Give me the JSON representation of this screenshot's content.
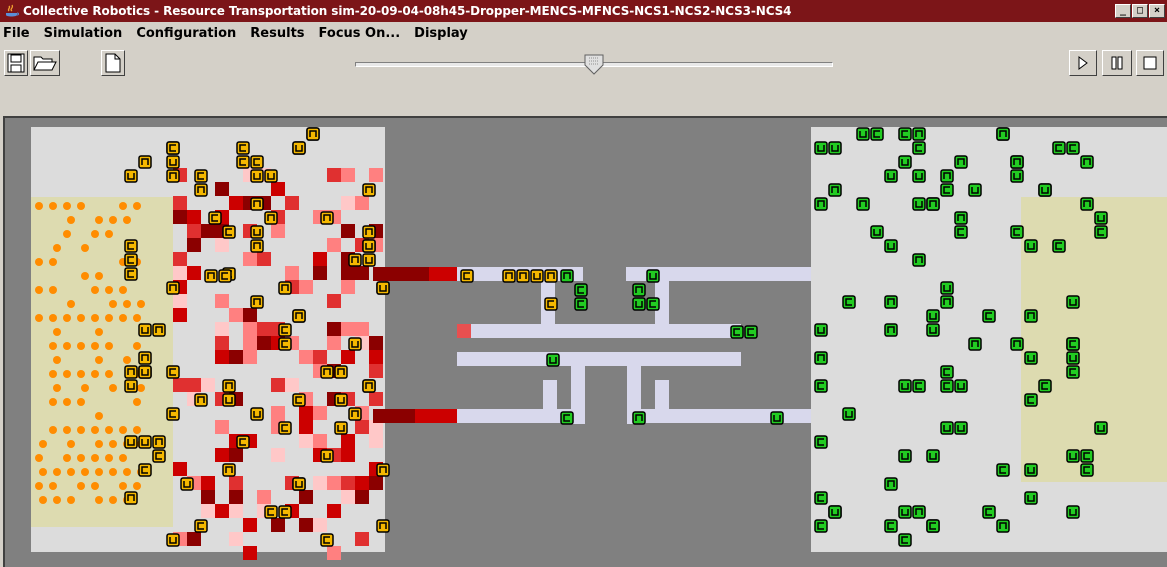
{
  "window": {
    "title": "Collective Robotics - Resource Transportation sim-20-09-04-08h45-Dropper-MENCS-MFNCS-NCS1-NCS2-NCS3-NCS4",
    "minimize": "_",
    "maximize": "□",
    "close": "×"
  },
  "menu": [
    "File",
    "Simulation",
    "Configuration",
    "Results",
    "Focus On...",
    "Display"
  ],
  "toolbar": {
    "left_icons": [
      "save-icon",
      "open-folder-icon",
      "new-file-icon"
    ],
    "right_icons": [
      "play-icon",
      "pause-icon",
      "stop-icon"
    ],
    "speed_slider_level": 0.5
  },
  "colors": {
    "area_bg": "#dcdcdc",
    "corridor_bg": "#808080",
    "path": "#d8d8ec",
    "zone": "#dddbb0",
    "orange_resource": "#ff8c00",
    "robot_yellow": "#f5b800",
    "robot_green": "#22cc22",
    "heat_dark": "#8b0000",
    "heat_mid": "#cc0000",
    "heat_light": "#ff8080"
  },
  "robot_glyphs": [
    "u",
    "n",
    "c",
    "ɔ",
    "o"
  ]
}
